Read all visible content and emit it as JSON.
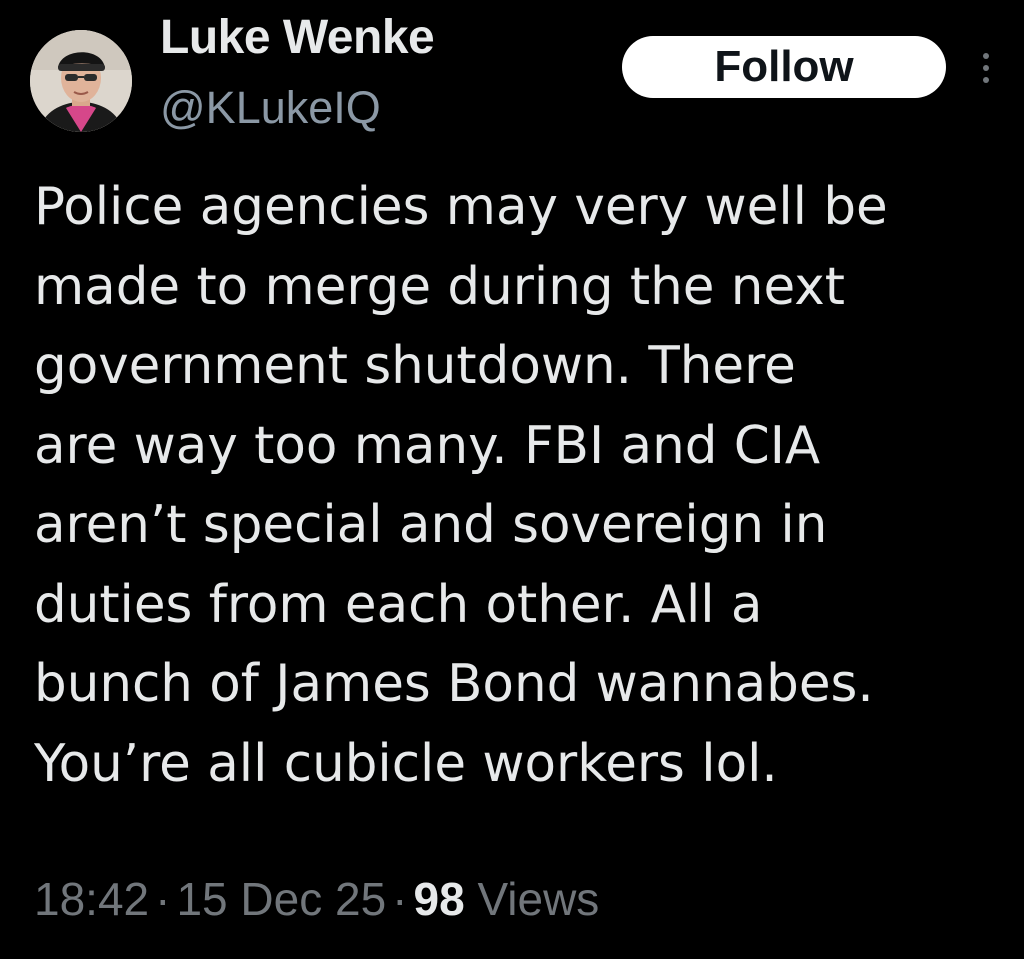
{
  "author": {
    "display_name": "Luke Wenke",
    "handle": "@KLukeIQ",
    "avatar_icon": "user-avatar-photo"
  },
  "actions": {
    "follow_label": "Follow",
    "more_icon": "more-vertical-icon"
  },
  "tweet": {
    "lines": [
      "Police agencies may very well be",
      "made to merge during the next",
      "government shutdown.  There",
      "are way too many.  FBI and CIA",
      "aren’t special and sovereign in",
      "duties from each other.  All a",
      "bunch of James Bond wannabes.",
      "You’re all cubicle workers lol."
    ]
  },
  "meta": {
    "time": "18:42",
    "separator": "·",
    "date": "15 Dec 25",
    "views_count": "98",
    "views_label": "Views"
  },
  "colors": {
    "background": "#000000",
    "primary_text": "#e7e9ea",
    "secondary_text": "#71767b",
    "handle_text": "#8b98a5",
    "follow_bg": "#ffffff",
    "follow_text": "#0f1419"
  }
}
